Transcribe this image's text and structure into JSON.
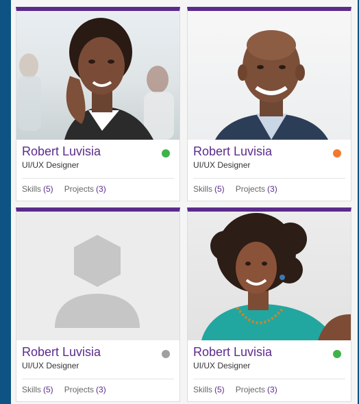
{
  "cards": [
    {
      "name": "Robert Luvisia",
      "role": "UI/UX Designer",
      "status_color": "#3fb24b",
      "skills_label": "Skills",
      "skills_count": "(5)",
      "projects_label": "Projects",
      "projects_count": "(3)",
      "photo": "woman-headshot-photo"
    },
    {
      "name": "Robert Luvisia",
      "role": "UI/UX Designer",
      "status_color": "#f07a2e",
      "skills_label": "Skills",
      "skills_count": "(5)",
      "projects_label": "Projects",
      "projects_count": "(3)",
      "photo": "man-headshot-photo"
    },
    {
      "name": "Robert Luvisia",
      "role": "UI/UX Designer",
      "status_color": "#a0a0a0",
      "skills_label": "Skills",
      "skills_count": "(5)",
      "projects_label": "Projects",
      "projects_count": "(3)",
      "photo": "default-avatar-placeholder"
    },
    {
      "name": "Robert Luvisia",
      "role": "UI/UX Designer",
      "status_color": "#3fb24b",
      "skills_label": "Skills",
      "skills_count": "(5)",
      "projects_label": "Projects",
      "projects_count": "(3)",
      "photo": "woman-curly-hair-photo"
    }
  ],
  "colors": {
    "accent": "#5b2b8c",
    "background": "#0d5484"
  }
}
